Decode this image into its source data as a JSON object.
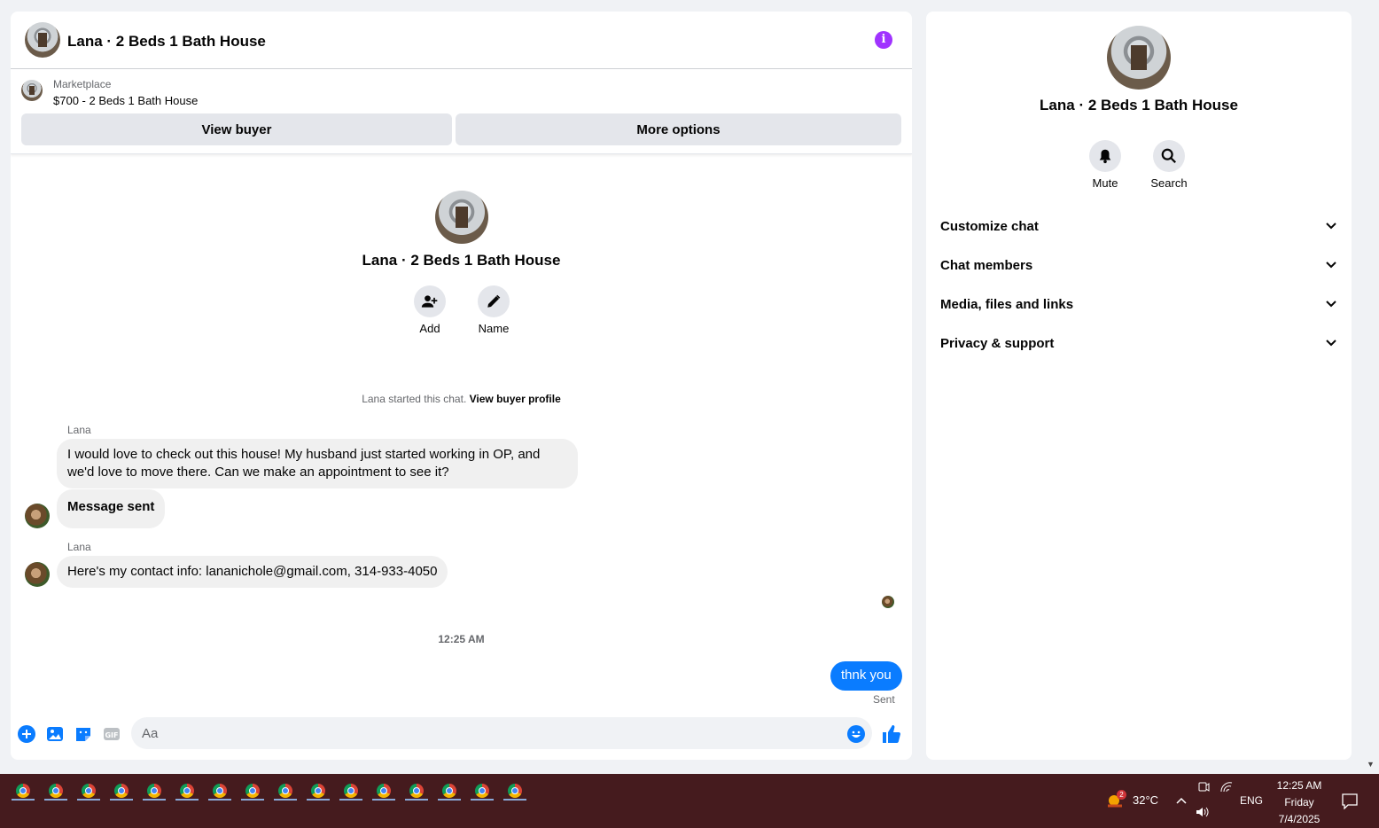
{
  "chat": {
    "header_title": "Lana · 2 Beds 1 Bath House",
    "listing": {
      "label": "Marketplace",
      "price_title": "$700 - 2 Beds 1 Bath House",
      "view_buyer": "View buyer",
      "more_options": "More options"
    },
    "intro": {
      "title": "Lana · 2 Beds 1 Bath House",
      "add_label": "Add",
      "name_label": "Name"
    },
    "started_text": "Lana started this chat.",
    "started_link": "View buyer profile",
    "messages": [
      {
        "sender": "Lana",
        "text": "I would love to check out this house! My husband just started working in OP, and we'd love to move there. Can we make an appointment to see it?"
      },
      {
        "sender": "",
        "text": "Message sent"
      },
      {
        "sender": "Lana",
        "text": "Here's my contact info: lananichole@gmail.com, 314-933-4050"
      }
    ],
    "timestamp": "12:25 AM",
    "outgoing": {
      "text": "thnk you",
      "status": "Sent"
    },
    "composer_placeholder": "Aa"
  },
  "info_panel": {
    "title": "Lana · 2 Beds 1 Bath House",
    "mute_label": "Mute",
    "search_label": "Search",
    "sections": [
      "Customize chat",
      "Chat members",
      "Media, files and links",
      "Privacy & support"
    ]
  },
  "taskbar": {
    "app_count": 16,
    "weather_badge": "2",
    "temperature": "32°C",
    "language": "ENG",
    "time": "12:25 AM",
    "day": "Friday",
    "date": "7/4/2025"
  },
  "colors": {
    "accent": "#0a7cff",
    "info": "#a033ff",
    "taskbar": "#451b1e"
  }
}
